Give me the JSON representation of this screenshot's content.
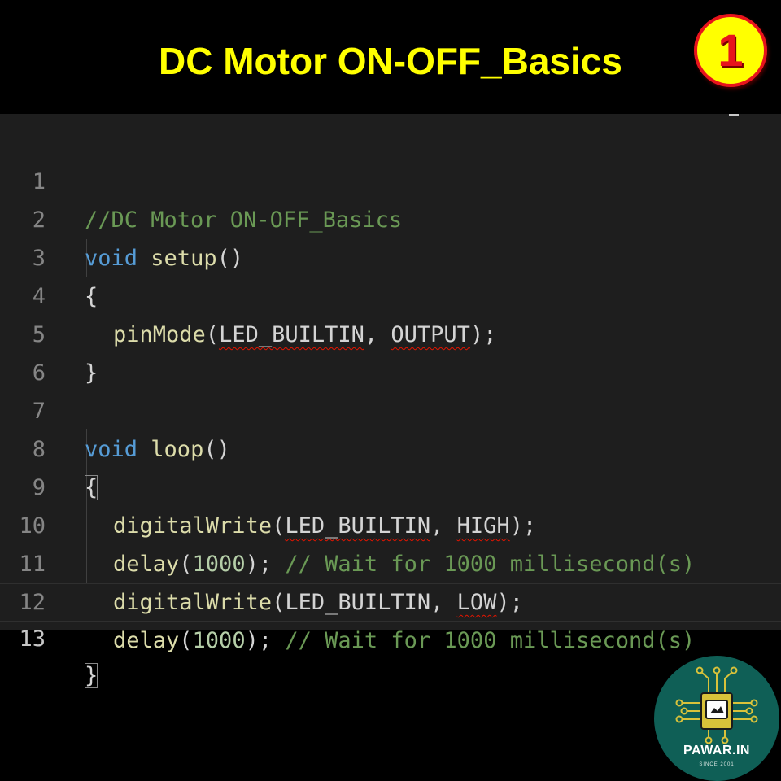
{
  "header": {
    "title": "DC Motor ON-OFF_Basics",
    "badge_number": "1"
  },
  "editor": {
    "lines": [
      {
        "number": "1",
        "text": "//DC Motor ON-OFF_Basics"
      },
      {
        "number": "2",
        "text": "void setup()"
      },
      {
        "number": "3",
        "text": "{"
      },
      {
        "number": "4",
        "text": "pinMode(LED_BUILTIN, OUTPUT);"
      },
      {
        "number": "5",
        "text": "}"
      },
      {
        "number": "6",
        "text": ""
      },
      {
        "number": "7",
        "text": "void loop()"
      },
      {
        "number": "8",
        "text": "{"
      },
      {
        "number": "9",
        "text": "digitalWrite(LED_BUILTIN, HIGH);"
      },
      {
        "number": "10",
        "text": "delay(1000); // Wait for 1000 millisecond(s)"
      },
      {
        "number": "11",
        "text": "digitalWrite(LED_BUILTIN, LOW);"
      },
      {
        "number": "12",
        "text": "delay(1000); // Wait for 1000 millisecond(s)"
      },
      {
        "number": "13",
        "text": "}"
      }
    ],
    "tokens": {
      "l1_comment": "//DC Motor ON-OFF_Basics",
      "kw_void": "void",
      "fn_setup": "setup",
      "parens": "()",
      "brace_open": "{",
      "brace_close": "}",
      "fn_pinmode": "pinMode",
      "const_led": "LED_BUILTIN",
      "const_output": "OUTPUT",
      "fn_loop": "loop",
      "fn_digitalwrite": "digitalWrite",
      "const_high": "HIGH",
      "const_low": "LOW",
      "fn_delay": "delay",
      "num_1000": "1000",
      "comment_wait": "// Wait for 1000 millisecond(s)"
    },
    "colors": {
      "background": "#1e1e1e",
      "comment": "#6a9955",
      "keyword": "#569cd6",
      "function": "#dcdcaa",
      "number": "#b5cea8",
      "text": "#d4d4d4",
      "error_squiggle": "#e51400"
    },
    "active_line": "13"
  },
  "logo": {
    "name": "PAWAR.IN",
    "tagline": "SINCE 2001",
    "icon": "circuit-chip-icon"
  },
  "colors": {
    "title": "#ffff00",
    "badge_fill": "#ffff00",
    "badge_border": "#e8141c",
    "page_background": "#000000",
    "logo_background": "#0f5f56"
  }
}
